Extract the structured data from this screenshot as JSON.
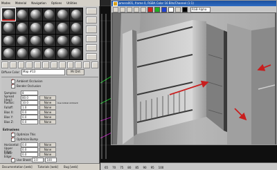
{
  "material_editor": {
    "menu": [
      "Modes",
      "Material",
      "Navigation",
      "Options",
      "Utilities"
    ],
    "map_row": {
      "label": "Diffuse Color:",
      "map_name": "Map #13",
      "map_type": "Mr Dirt"
    },
    "checkboxes": [
      {
        "label": "Ambient Occlusion",
        "checked": true
      },
      {
        "label": "Bender Occlusion",
        "checked": true
      }
    ],
    "spinners": [
      {
        "label": "Samples:",
        "value": "8"
      },
      {
        "label": "Spread [deg]:",
        "value": "80.0",
        "btn": "None"
      },
      {
        "label": "Radius:",
        "value": "10.0",
        "btn": "None",
        "note": "Use Global Ambient"
      },
      {
        "label": "Falloff:",
        "value": "1.0",
        "btn": "None"
      },
      {
        "label": "Bias X:",
        "value": "0.0",
        "btn": "None"
      },
      {
        "label": "Bias Y:",
        "value": "0.0",
        "btn": "None"
      },
      {
        "label": "Bias Z:",
        "value": "0.0",
        "btn": "None"
      }
    ],
    "extrusion_title": "Extrusions",
    "extrusion_checks": [
      {
        "label": "Optimize This",
        "checked": true
      },
      {
        "label": "Optimize Bump",
        "checked": true
      }
    ],
    "extrusion_spinners": [
      {
        "label": "Horizontal:",
        "value": "0.0",
        "btn": "None"
      },
      {
        "label": "Upper Edge:",
        "value": "0.0",
        "btn": "None"
      },
      {
        "label": "Lower Edge:",
        "value": "0.0",
        "btn": "None"
      }
    ],
    "bottom_row": {
      "label": "Use Sheet",
      "value1": "3.0",
      "value2": "100"
    },
    "status": [
      "Documentation [web]",
      "Tutorials [web]",
      "Bug [web]"
    ]
  },
  "render_window": {
    "title": "Camera001, frame 0, RGBA Color 16 Bits/Channel (1:1)",
    "channel": "RGB Alpha"
  },
  "viewport": {
    "timeline": [
      "65",
      "70",
      "75",
      "80",
      "85",
      "90",
      "95",
      "100"
    ]
  },
  "colors": {
    "arrow": "#c81e1e",
    "title_bar": "#2f6cc2",
    "editor_bg": "#c8c8c8"
  }
}
